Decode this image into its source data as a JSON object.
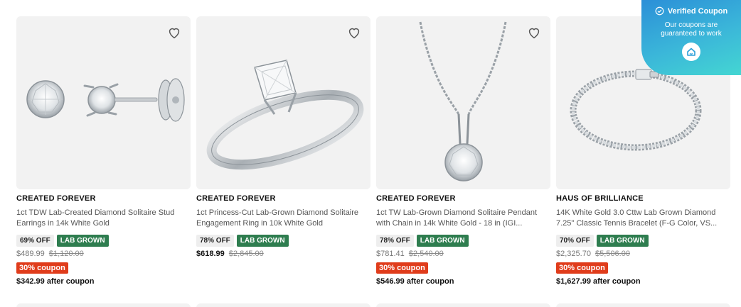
{
  "products": [
    {
      "brand": "CREATED FOREVER",
      "title": "1ct TDW Lab-Created Diamond Solitaire Stud Earrings in 14k White Gold",
      "discount": "69% OFF",
      "tag": "LAB GROWN",
      "price": "$489.99",
      "original_price": "$1,120.00",
      "coupon": "30% coupon",
      "after_coupon": "$342.99 after coupon",
      "icon": "heart-icon"
    },
    {
      "brand": "CREATED FOREVER",
      "title": "1ct Princess-Cut Lab-Grown Diamond Solitaire Engagement Ring in 10k White Gold",
      "discount": "78% OFF",
      "tag": "LAB GROWN",
      "price": "$618.99",
      "original_price": "$2,845.00",
      "icon": "heart-icon"
    },
    {
      "brand": "CREATED FOREVER",
      "title": "1ct TW Lab-Grown Diamond Solitaire Pendant with Chain in 14k White Gold - 18 in (IGI...",
      "discount": "78% OFF",
      "tag": "LAB GROWN",
      "price": "$781.41",
      "original_price": "$2,540.00",
      "coupon": "30% coupon",
      "after_coupon": "$546.99 after coupon",
      "icon": "heart-icon"
    },
    {
      "brand": "HAUS OF BRILLIANCE",
      "title": "14K White Gold 3.0 Cttw Lab Grown Diamond 7.25\" Classic Tennis Bracelet (F-G Color, VS...",
      "discount": "70% OFF",
      "tag": "LAB GROWN",
      "price": "$2,325.70",
      "original_price": "$5,506.00",
      "coupon": "30% coupon",
      "after_coupon": "$1,627.99 after coupon",
      "icon": "heart-icon"
    }
  ],
  "verified_banner": {
    "title": "Verified Coupon",
    "subtitle": "Our coupons are guaranteed to work",
    "check_icon": "check-circle-icon",
    "brand_icon": "house-logo-icon"
  },
  "colors": {
    "lab_grown_tag": "#2e7d4f",
    "coupon_badge": "#e03c1b",
    "banner_gradient_start": "#2b8fd8",
    "banner_gradient_end": "#44d6d2"
  }
}
